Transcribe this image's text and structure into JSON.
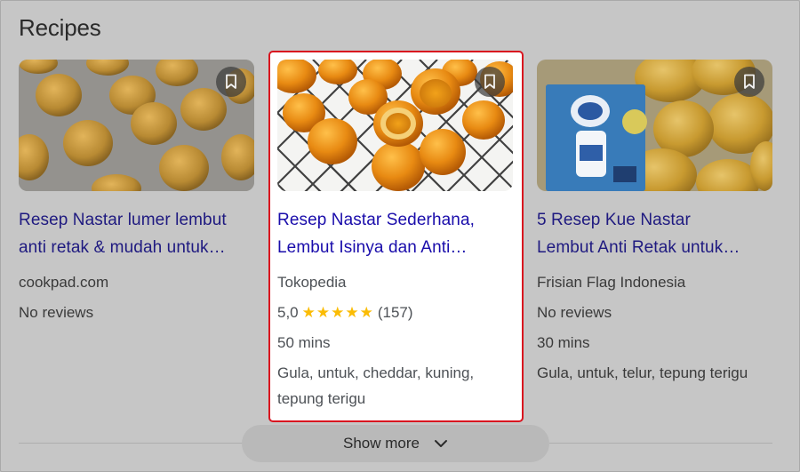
{
  "section": {
    "heading": "Recipes"
  },
  "cards": [
    {
      "title_line1": "Resep Nastar lumer lembut",
      "title_line2": "anti retak & mudah untuk…",
      "source": "cookpad.com",
      "reviews": "No reviews"
    },
    {
      "title_line1": "Resep Nastar Sederhana,",
      "title_line2": "Lembut Isinya dan Anti…",
      "source": "Tokopedia",
      "rating": "5,0",
      "stars": "★★★★★",
      "rating_count": "(157)",
      "rating_value": 5.0,
      "time": "50 mins",
      "ingredients_line1": "Gula, untuk, cheddar, kuning,",
      "ingredients_line2": "tepung terigu"
    },
    {
      "title_line1": "5 Resep Kue Nastar",
      "title_line2": "Lembut Anti Retak untuk…",
      "source": "Frisian Flag Indonesia",
      "reviews": "No reviews",
      "time": "30 mins",
      "ingredients_line1": "Gula, untuk, telur, tepung terigu"
    }
  ],
  "footer": {
    "show_more_label": "Show more"
  },
  "colors": {
    "highlight_border": "#d9131f",
    "link": "#1a0dab",
    "star": "#fbbc04",
    "overlay_background": "#c6c6c6"
  }
}
